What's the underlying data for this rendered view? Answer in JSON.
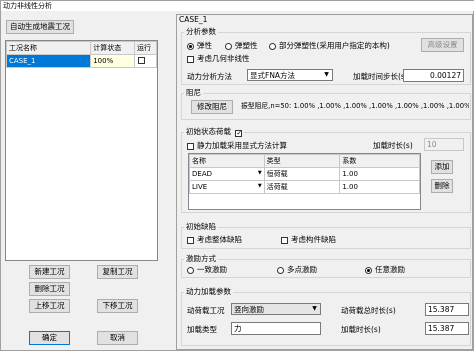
{
  "window": {
    "title": "动力非线性分析"
  },
  "left": {
    "auto_button": "自动生成地震工况",
    "table": {
      "headers": [
        "工况名称",
        "计算状态",
        "运行"
      ],
      "rows": [
        {
          "name": "CASE_1",
          "status": "100%",
          "run": ""
        }
      ]
    },
    "buttons": {
      "new": "新建工况",
      "copy": "复制工况",
      "delete": "删除工况",
      "move_up": "上移工况",
      "move_down": "下移工况",
      "ok": "确定",
      "cancel": "取消"
    }
  },
  "right": {
    "case_name": "CASE_1",
    "analysis_params": {
      "title": "分析参数",
      "radio_elastic": "弹性",
      "radio_elastoplastic": "弹塑性",
      "radio_partial": "部分弹塑性(采用用户指定的本构)",
      "advanced_button": "高级设置",
      "geo_nonlinear": "考虑几何非线性",
      "method_label": "动力分析方法",
      "method_value": "显式FNA方法",
      "time_step_label": "加载时间步长(s)",
      "time_step_value": "0.00127"
    },
    "damping": {
      "title": "阻尼",
      "modify_button": "修改阻尼",
      "text": "振型阻尼,n=50: 1.00% ,1.00% ,1.00% ,1.00% ,1.00% ,1.00% ,1.00% ,1.00% ,1.00% ,1.00% ,1.00"
    },
    "initial_state": {
      "title": "初始状态荷载",
      "static_label": "静力加载采用显式方法计算",
      "duration_label": "加载时长(s)",
      "duration_value": "10",
      "table_headers": [
        "名称",
        "类型",
        "系数"
      ],
      "rows": [
        {
          "name": "DEAD",
          "type": "恒荷载",
          "coef": "1.00"
        },
        {
          "name": "LIVE",
          "type": "活荷载",
          "coef": "1.00"
        }
      ],
      "add_button": "添加",
      "delete_button": "删除"
    },
    "initial_defect": {
      "title": "初始缺陷",
      "overall": "考虑整体缺陷",
      "member": "考虑构件缺陷"
    },
    "excitation": {
      "title": "激励方式",
      "uniform": "一致激励",
      "multi": "多点激励",
      "arbitrary": "任意激励"
    },
    "dynamic_load": {
      "title": "动力加载参数",
      "case_label": "动荷载工况",
      "case_value": "竖向激励",
      "total_label": "动荷载总时长(s)",
      "total_value": "15.387",
      "type_label": "加载类型",
      "type_value": "力",
      "duration_label": "加载时长(s)",
      "duration_value": "15.387"
    }
  }
}
